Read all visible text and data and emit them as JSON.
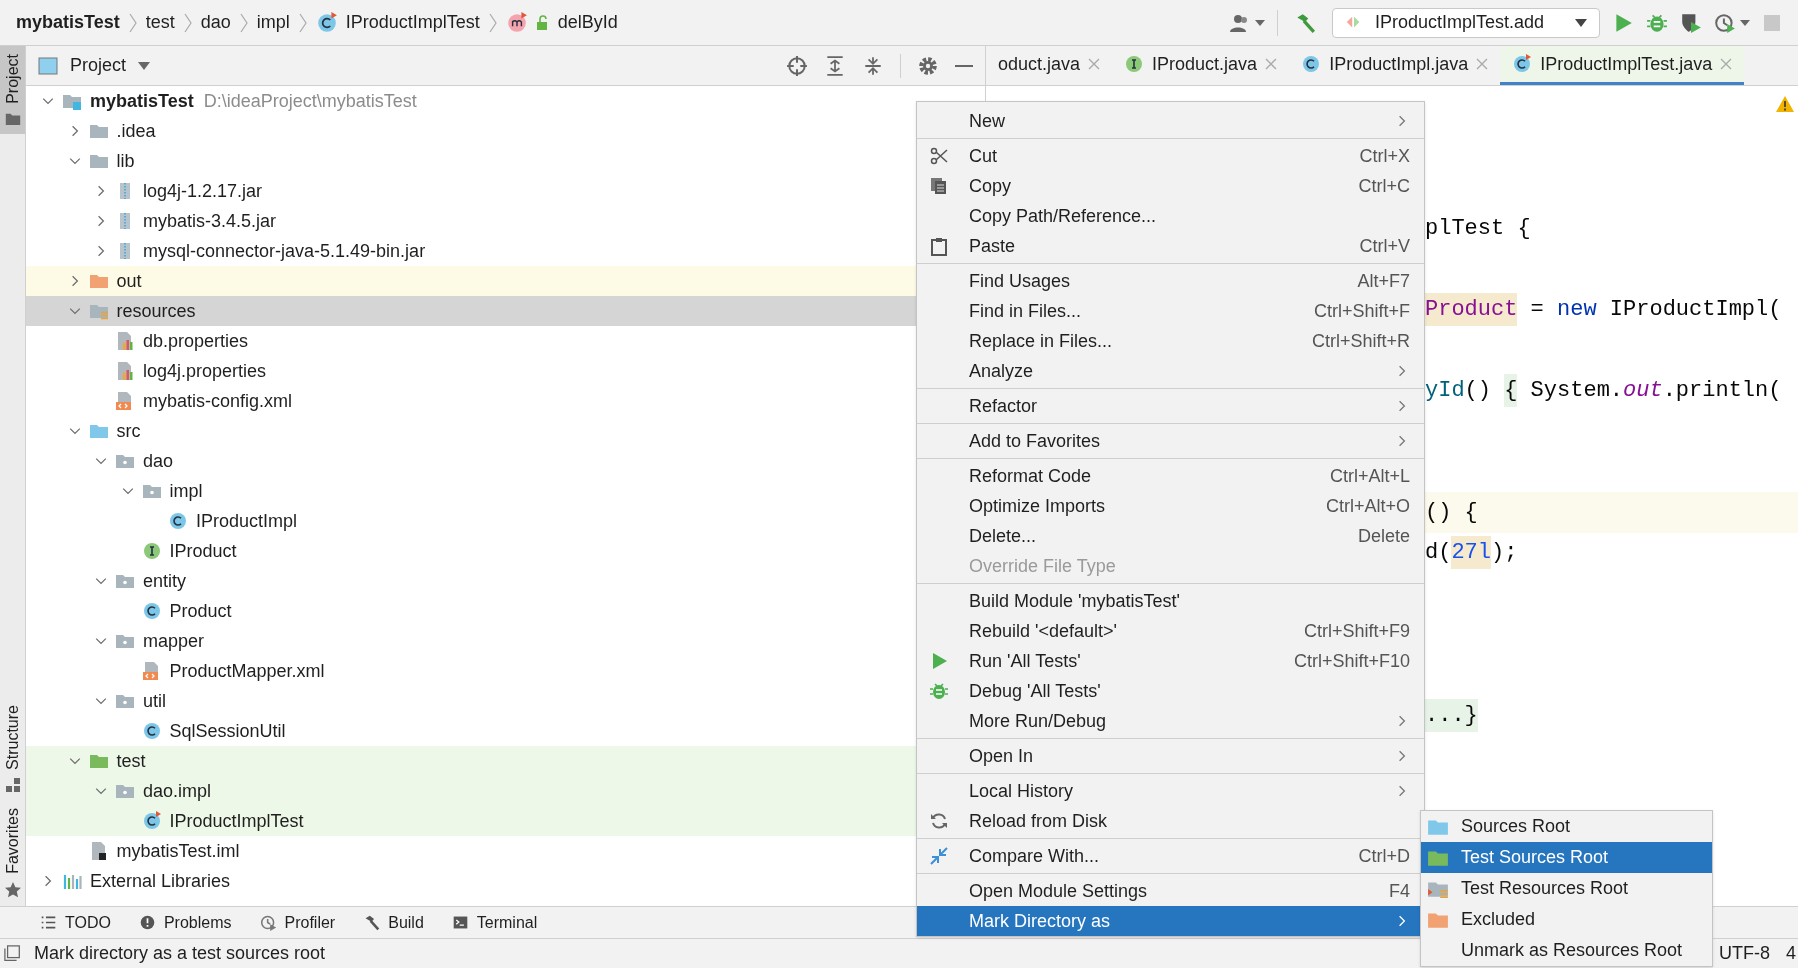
{
  "breadcrumbs": [
    {
      "label": "mybatisTest",
      "kind": "module"
    },
    {
      "label": "test",
      "kind": "folder"
    },
    {
      "label": "dao",
      "kind": "folder"
    },
    {
      "label": "impl",
      "kind": "folder"
    },
    {
      "label": "IProductImplTest",
      "kind": "test-class"
    },
    {
      "label": "delById",
      "kind": "method"
    }
  ],
  "toolbar": {
    "run_configuration": "IProductImplTest.add",
    "stop_disabled": true
  },
  "side_tabs": [
    {
      "label": "Project",
      "selected": true
    },
    {
      "label": "Structure",
      "selected": false
    },
    {
      "label": "Favorites",
      "selected": false
    }
  ],
  "project_view": {
    "title": "Project"
  },
  "project_tree": [
    {
      "label": "mybatisTest",
      "path": "D:\\ideaProject\\mybatisTest",
      "kind": "module",
      "expanded": true,
      "selected": false,
      "children": [
        {
          "label": ".idea",
          "kind": "folder",
          "expanded": false,
          "selected": false
        },
        {
          "label": "lib",
          "kind": "folder",
          "expanded": true,
          "selected": false,
          "children": [
            {
              "label": "log4j-1.2.17.jar",
              "kind": "jar",
              "expanded": false,
              "selected": false
            },
            {
              "label": "mybatis-3.4.5.jar",
              "kind": "jar",
              "expanded": false,
              "selected": false
            },
            {
              "label": "mysql-connector-java-5.1.49-bin.jar",
              "kind": "jar",
              "expanded": false,
              "selected": false
            }
          ]
        },
        {
          "label": "out",
          "kind": "folder-excluded",
          "expanded": false,
          "selected": false,
          "excluded": true
        },
        {
          "label": "resources",
          "kind": "folder-resources",
          "expanded": true,
          "selected": true,
          "children": [
            {
              "label": "db.properties",
              "kind": "properties",
              "selected": false
            },
            {
              "label": "log4j.properties",
              "kind": "properties",
              "selected": false
            },
            {
              "label": "mybatis-config.xml",
              "kind": "xml",
              "selected": false
            }
          ]
        },
        {
          "label": "src",
          "kind": "folder-source",
          "expanded": true,
          "selected": false,
          "children": [
            {
              "label": "dao",
              "kind": "package",
              "expanded": true,
              "selected": false,
              "children": [
                {
                  "label": "impl",
                  "kind": "package",
                  "expanded": true,
                  "selected": false,
                  "children": [
                    {
                      "label": "IProductImpl",
                      "kind": "class",
                      "selected": false
                    }
                  ]
                },
                {
                  "label": "IProduct",
                  "kind": "interface",
                  "selected": false
                }
              ]
            },
            {
              "label": "entity",
              "kind": "package",
              "expanded": true,
              "selected": false,
              "children": [
                {
                  "label": "Product",
                  "kind": "class",
                  "selected": false
                }
              ]
            },
            {
              "label": "mapper",
              "kind": "package",
              "expanded": true,
              "selected": false,
              "children": [
                {
                  "label": "ProductMapper.xml",
                  "kind": "xml",
                  "selected": false
                }
              ]
            },
            {
              "label": "util",
              "kind": "package",
              "expanded": true,
              "selected": false,
              "children": [
                {
                  "label": "SqlSessionUtil",
                  "kind": "class",
                  "selected": false
                }
              ]
            }
          ]
        },
        {
          "label": "test",
          "kind": "folder-test",
          "expanded": true,
          "selected": false,
          "in_test_root": true,
          "children": [
            {
              "label": "dao.impl",
              "kind": "package",
              "expanded": true,
              "selected": false,
              "in_test_root": true,
              "children": [
                {
                  "label": "IProductImplTest",
                  "kind": "test-class",
                  "selected": false,
                  "in_test_root": true
                }
              ]
            }
          ]
        },
        {
          "label": "mybatisTest.iml",
          "kind": "iml",
          "selected": false
        }
      ]
    },
    {
      "label": "External Libraries",
      "kind": "libraries",
      "expanded": false,
      "selected": false
    }
  ],
  "editor_tabs": [
    {
      "label": "oduct.java",
      "kind": "none",
      "selected": false
    },
    {
      "label": "IProduct.java",
      "kind": "interface",
      "selected": false
    },
    {
      "label": "IProductImpl.java",
      "kind": "class",
      "selected": false
    },
    {
      "label": "IProductImplTest.java",
      "kind": "test-class",
      "selected": true
    }
  ],
  "editor": {
    "warning": true,
    "lines": [
      {
        "current": false,
        "tokens": [
          {
            "text": "plTest {",
            "kind": "plain"
          }
        ]
      },
      {
        "current": false,
        "tokens": [
          {
            "text": "Product",
            "kind": "field",
            "usage_highlight": true
          },
          {
            "text": " = ",
            "kind": "plain"
          },
          {
            "text": "new",
            "kind": "keyword"
          },
          {
            "text": " IProductImpl(",
            "kind": "plain"
          }
        ]
      },
      {
        "current": false,
        "tokens": [
          {
            "text": "yId",
            "kind": "method"
          },
          {
            "text": "() ",
            "kind": "plain"
          },
          {
            "text": "{",
            "kind": "plain",
            "folded": true
          },
          {
            "text": " System.",
            "kind": "plain"
          },
          {
            "text": "out",
            "kind": "static"
          },
          {
            "text": ".println(",
            "kind": "plain"
          }
        ]
      },
      {
        "current": true,
        "tokens": [
          {
            "text": "() {",
            "kind": "plain"
          }
        ]
      },
      {
        "current": false,
        "tokens": [
          {
            "text": "d(",
            "kind": "plain"
          },
          {
            "text": "27l",
            "kind": "number",
            "usage_highlight": true
          },
          {
            "text": ");",
            "kind": "plain"
          }
        ]
      },
      {
        "current": false,
        "tokens": [
          {
            "text": "...}",
            "kind": "plain",
            "folded": true
          }
        ]
      }
    ]
  },
  "context_menu": {
    "groups": [
      [
        {
          "label": "New",
          "submenu": true,
          "selected": false
        }
      ],
      [
        {
          "label": "Cut",
          "shortcut": "Ctrl+X",
          "kind": "cut",
          "selected": false
        },
        {
          "label": "Copy",
          "shortcut": "Ctrl+C",
          "kind": "copy",
          "selected": false
        },
        {
          "label": "Copy Path/Reference...",
          "selected": false
        },
        {
          "label": "Paste",
          "shortcut": "Ctrl+V",
          "kind": "paste",
          "selected": false
        }
      ],
      [
        {
          "label": "Find Usages",
          "shortcut": "Alt+F7",
          "selected": false
        },
        {
          "label": "Find in Files...",
          "shortcut": "Ctrl+Shift+F",
          "selected": false
        },
        {
          "label": "Replace in Files...",
          "shortcut": "Ctrl+Shift+R",
          "selected": false
        },
        {
          "label": "Analyze",
          "submenu": true,
          "selected": false
        }
      ],
      [
        {
          "label": "Refactor",
          "submenu": true,
          "selected": false
        }
      ],
      [
        {
          "label": "Add to Favorites",
          "submenu": true,
          "selected": false
        }
      ],
      [
        {
          "label": "Reformat Code",
          "shortcut": "Ctrl+Alt+L",
          "selected": false
        },
        {
          "label": "Optimize Imports",
          "shortcut": "Ctrl+Alt+O",
          "selected": false
        },
        {
          "label": "Delete...",
          "shortcut": "Delete",
          "selected": false
        },
        {
          "label": "Override File Type",
          "disabled": true,
          "selected": false
        }
      ],
      [
        {
          "label": "Build Module 'mybatisTest'",
          "selected": false
        },
        {
          "label": "Rebuild '<default>'",
          "shortcut": "Ctrl+Shift+F9",
          "selected": false
        },
        {
          "label": "Run 'All Tests'",
          "shortcut": "Ctrl+Shift+F10",
          "kind": "run",
          "selected": false
        },
        {
          "label": "Debug 'All Tests'",
          "kind": "debug",
          "selected": false
        },
        {
          "label": "More Run/Debug",
          "submenu": true,
          "selected": false
        }
      ],
      [
        {
          "label": "Open In",
          "submenu": true,
          "selected": false
        }
      ],
      [
        {
          "label": "Local History",
          "submenu": true,
          "selected": false
        },
        {
          "label": "Reload from Disk",
          "kind": "reload",
          "selected": false
        }
      ],
      [
        {
          "label": "Compare With...",
          "shortcut": "Ctrl+D",
          "kind": "compare",
          "selected": false
        }
      ],
      [
        {
          "label": "Open Module Settings",
          "shortcut": "F4",
          "selected": false
        },
        {
          "label": "Mark Directory as",
          "submenu": true,
          "selected": true
        }
      ]
    ]
  },
  "submenu": [
    {
      "label": "Sources Root",
      "kind": "folder-source",
      "selected": false
    },
    {
      "label": "Test Sources Root",
      "kind": "folder-test",
      "selected": true
    },
    {
      "label": "Test Resources Root",
      "kind": "folder-test-resources",
      "selected": false
    },
    {
      "label": "Excluded",
      "kind": "folder-excluded",
      "selected": false
    },
    {
      "label": "Unmark as Resources Root",
      "selected": false
    }
  ],
  "tool_windows": [
    {
      "label": "TODO",
      "kind": "list"
    },
    {
      "label": "Problems",
      "kind": "problems"
    },
    {
      "label": "Profiler",
      "kind": "profiler"
    },
    {
      "label": "Build",
      "kind": "build"
    },
    {
      "label": "Terminal",
      "kind": "terminal"
    }
  ],
  "status_bar": {
    "message": "Mark directory as a test sources root",
    "items": [
      "UTF-8",
      "4"
    ]
  }
}
